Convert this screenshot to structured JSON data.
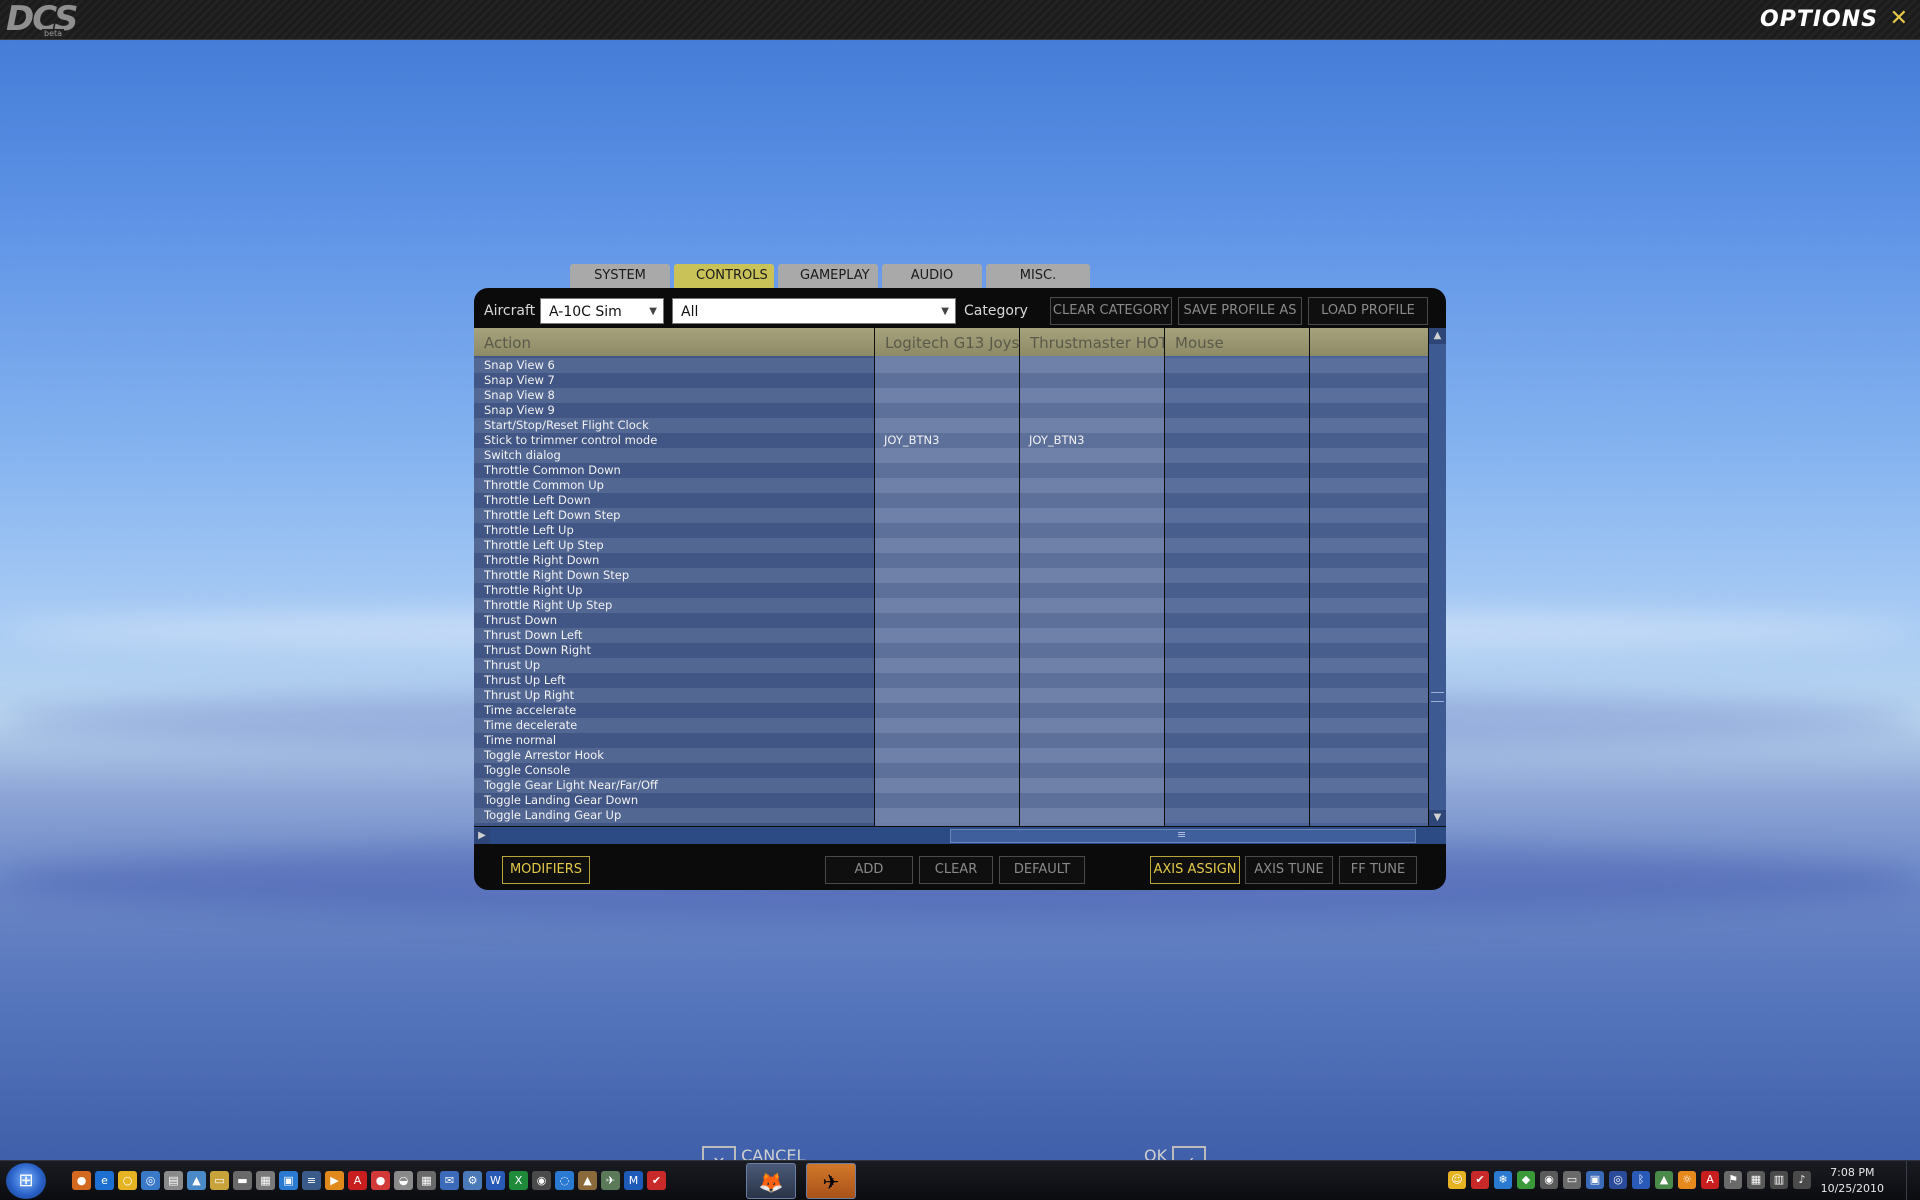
{
  "app": {
    "logo": "DCS",
    "logo_tag": "beta",
    "title": "OPTIONS",
    "close_glyph": "✕"
  },
  "tabs": [
    {
      "label": "SYSTEM",
      "active": false
    },
    {
      "label": "CONTROLS",
      "active": true
    },
    {
      "label": "GAMEPLAY",
      "active": false
    },
    {
      "label": "AUDIO",
      "active": false
    },
    {
      "label": "MISC.",
      "active": false
    }
  ],
  "filters": {
    "aircraft_label": "Aircraft",
    "aircraft_value": "A-10C Sim",
    "category_value": "All",
    "category_label": "Category",
    "clear_category": "CLEAR CATEGORY",
    "save_profile": "SAVE PROFILE AS",
    "load_profile": "LOAD PROFILE"
  },
  "table": {
    "headers": [
      "Action",
      "Logitech G13 Joys",
      "Thrustmaster HOT",
      "Mouse",
      ""
    ],
    "rows": [
      {
        "action": "Snap View 6",
        "c1": "",
        "c2": ""
      },
      {
        "action": "Snap View 7",
        "c1": "",
        "c2": ""
      },
      {
        "action": "Snap View 8",
        "c1": "",
        "c2": ""
      },
      {
        "action": "Snap View 9",
        "c1": "",
        "c2": ""
      },
      {
        "action": "Start/Stop/Reset Flight Clock",
        "c1": "",
        "c2": ""
      },
      {
        "action": "Stick to trimmer control mode",
        "c1": "JOY_BTN3",
        "c2": "JOY_BTN3"
      },
      {
        "action": "Switch dialog",
        "c1": "",
        "c2": ""
      },
      {
        "action": "Throttle Common Down",
        "c1": "",
        "c2": ""
      },
      {
        "action": "Throttle Common Up",
        "c1": "",
        "c2": ""
      },
      {
        "action": "Throttle Left Down",
        "c1": "",
        "c2": ""
      },
      {
        "action": "Throttle Left Down Step",
        "c1": "",
        "c2": ""
      },
      {
        "action": "Throttle Left Up",
        "c1": "",
        "c2": ""
      },
      {
        "action": "Throttle Left Up Step",
        "c1": "",
        "c2": ""
      },
      {
        "action": "Throttle Right Down",
        "c1": "",
        "c2": ""
      },
      {
        "action": "Throttle Right Down Step",
        "c1": "",
        "c2": ""
      },
      {
        "action": "Throttle Right Up",
        "c1": "",
        "c2": ""
      },
      {
        "action": "Throttle Right Up Step",
        "c1": "",
        "c2": ""
      },
      {
        "action": "Thrust Down",
        "c1": "",
        "c2": ""
      },
      {
        "action": "Thrust Down Left",
        "c1": "",
        "c2": ""
      },
      {
        "action": "Thrust Down Right",
        "c1": "",
        "c2": ""
      },
      {
        "action": "Thrust Up",
        "c1": "",
        "c2": ""
      },
      {
        "action": "Thrust Up Left",
        "c1": "",
        "c2": ""
      },
      {
        "action": "Thrust Up Right",
        "c1": "",
        "c2": ""
      },
      {
        "action": "Time accelerate",
        "c1": "",
        "c2": ""
      },
      {
        "action": "Time decelerate",
        "c1": "",
        "c2": ""
      },
      {
        "action": "Time normal",
        "c1": "",
        "c2": ""
      },
      {
        "action": "Toggle Arrestor Hook",
        "c1": "",
        "c2": ""
      },
      {
        "action": "Toggle Console",
        "c1": "",
        "c2": ""
      },
      {
        "action": "Toggle Gear Light Near/Far/Off",
        "c1": "",
        "c2": ""
      },
      {
        "action": "Toggle Landing Gear Down",
        "c1": "",
        "c2": ""
      },
      {
        "action": "Toggle Landing Gear Up",
        "c1": "",
        "c2": ""
      }
    ]
  },
  "bottom": {
    "modifiers": "MODIFIERS",
    "add": "ADD",
    "clear": "CLEAR",
    "default": "DEFAULT",
    "axis_assign": "AXIS ASSIGN",
    "axis_tune": "AXIS TUNE",
    "ff_tune": "FF TUNE"
  },
  "behind_taskbar": {
    "cancel": "CANCEL",
    "ok": "OK"
  },
  "taskbar": {
    "time": "7:08 PM",
    "date": "10/25/2010"
  },
  "colors": {
    "accent": "#e3c94a",
    "active_tab": "#c9c258",
    "header": "#a6a27c"
  }
}
